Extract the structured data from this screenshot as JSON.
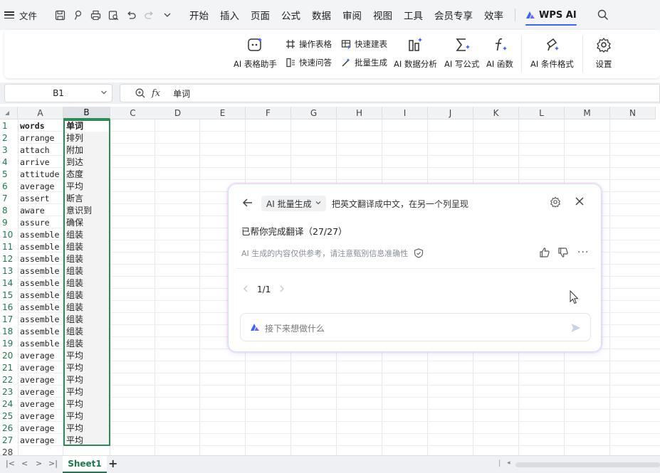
{
  "menubar": {
    "file_label": "文件",
    "tabs": [
      "开始",
      "插入",
      "页面",
      "公式",
      "数据",
      "审阅",
      "视图",
      "工具",
      "会员专享",
      "效率"
    ],
    "wps_ai_label": "WPS AI"
  },
  "ribbon": {
    "ai_table_assistant": "AI 表格助手",
    "operate_table": "操作表格",
    "quick_build_table": "快速建表",
    "quick_qa": "快速问答",
    "batch_generate": "批量生成",
    "ai_data_analysis": "AI 数据分析",
    "ai_write_formula": "AI 写公式",
    "ai_function": "AI 函数",
    "ai_conditional_format": "AI 条件格式",
    "settings": "设置"
  },
  "formula_bar": {
    "cell_ref": "B1",
    "fx_label": "fx",
    "value": "单词"
  },
  "grid": {
    "columns": [
      "A",
      "B",
      "C",
      "D",
      "E",
      "F",
      "G",
      "H",
      "I",
      "J",
      "K",
      "L",
      "M",
      "N"
    ],
    "selected_column": "B",
    "row_numbers": [
      "1",
      "2",
      "3",
      "4",
      "5",
      "6",
      "7",
      "8",
      "9",
      "10",
      "11",
      "12",
      "13",
      "14",
      "15",
      "16",
      "17",
      "18",
      "19",
      "20",
      "21",
      "22",
      "23",
      "24",
      "25",
      "26",
      "27",
      "28"
    ],
    "rows": [
      [
        "words",
        "单词"
      ],
      [
        "arrange",
        "排列"
      ],
      [
        "attach",
        "附加"
      ],
      [
        "arrive",
        "到达"
      ],
      [
        "attitude",
        "态度"
      ],
      [
        "average",
        "平均"
      ],
      [
        "assert",
        "断言"
      ],
      [
        "aware",
        "意识到"
      ],
      [
        "assure",
        "确保"
      ],
      [
        "assemble",
        "组装"
      ],
      [
        "assemble",
        "组装"
      ],
      [
        "assemble",
        "组装"
      ],
      [
        "assemble",
        "组装"
      ],
      [
        "assemble",
        "组装"
      ],
      [
        "assemble",
        "组装"
      ],
      [
        "assemble",
        "组装"
      ],
      [
        "assemble",
        "组装"
      ],
      [
        "assemble",
        "组装"
      ],
      [
        "assemble",
        "组装"
      ],
      [
        "average",
        "平均"
      ],
      [
        "average",
        "平均"
      ],
      [
        "average",
        "平均"
      ],
      [
        "average",
        "平均"
      ],
      [
        "average",
        "平均"
      ],
      [
        "average",
        "平均"
      ],
      [
        "average",
        "平均"
      ],
      [
        "average",
        "平均"
      ],
      [
        "",
        ""
      ]
    ]
  },
  "sheet_tabs": {
    "active": "Sheet1",
    "add_label": "+"
  },
  "ai_panel": {
    "mode": "AI 批量生成",
    "prompt": "把英文翻译成中文，在另一个列呈现",
    "result": "已帮你完成翻译（27/27）",
    "disclaimer": "AI 生成的内容仅供参考，请注意甄别信息准确性",
    "pager": "1/1",
    "input_placeholder": "接下来想做什么",
    "more_label": "···"
  },
  "colors": {
    "accent_green": "#2e8b57",
    "wps_ai_blue": "#3a66ff"
  }
}
